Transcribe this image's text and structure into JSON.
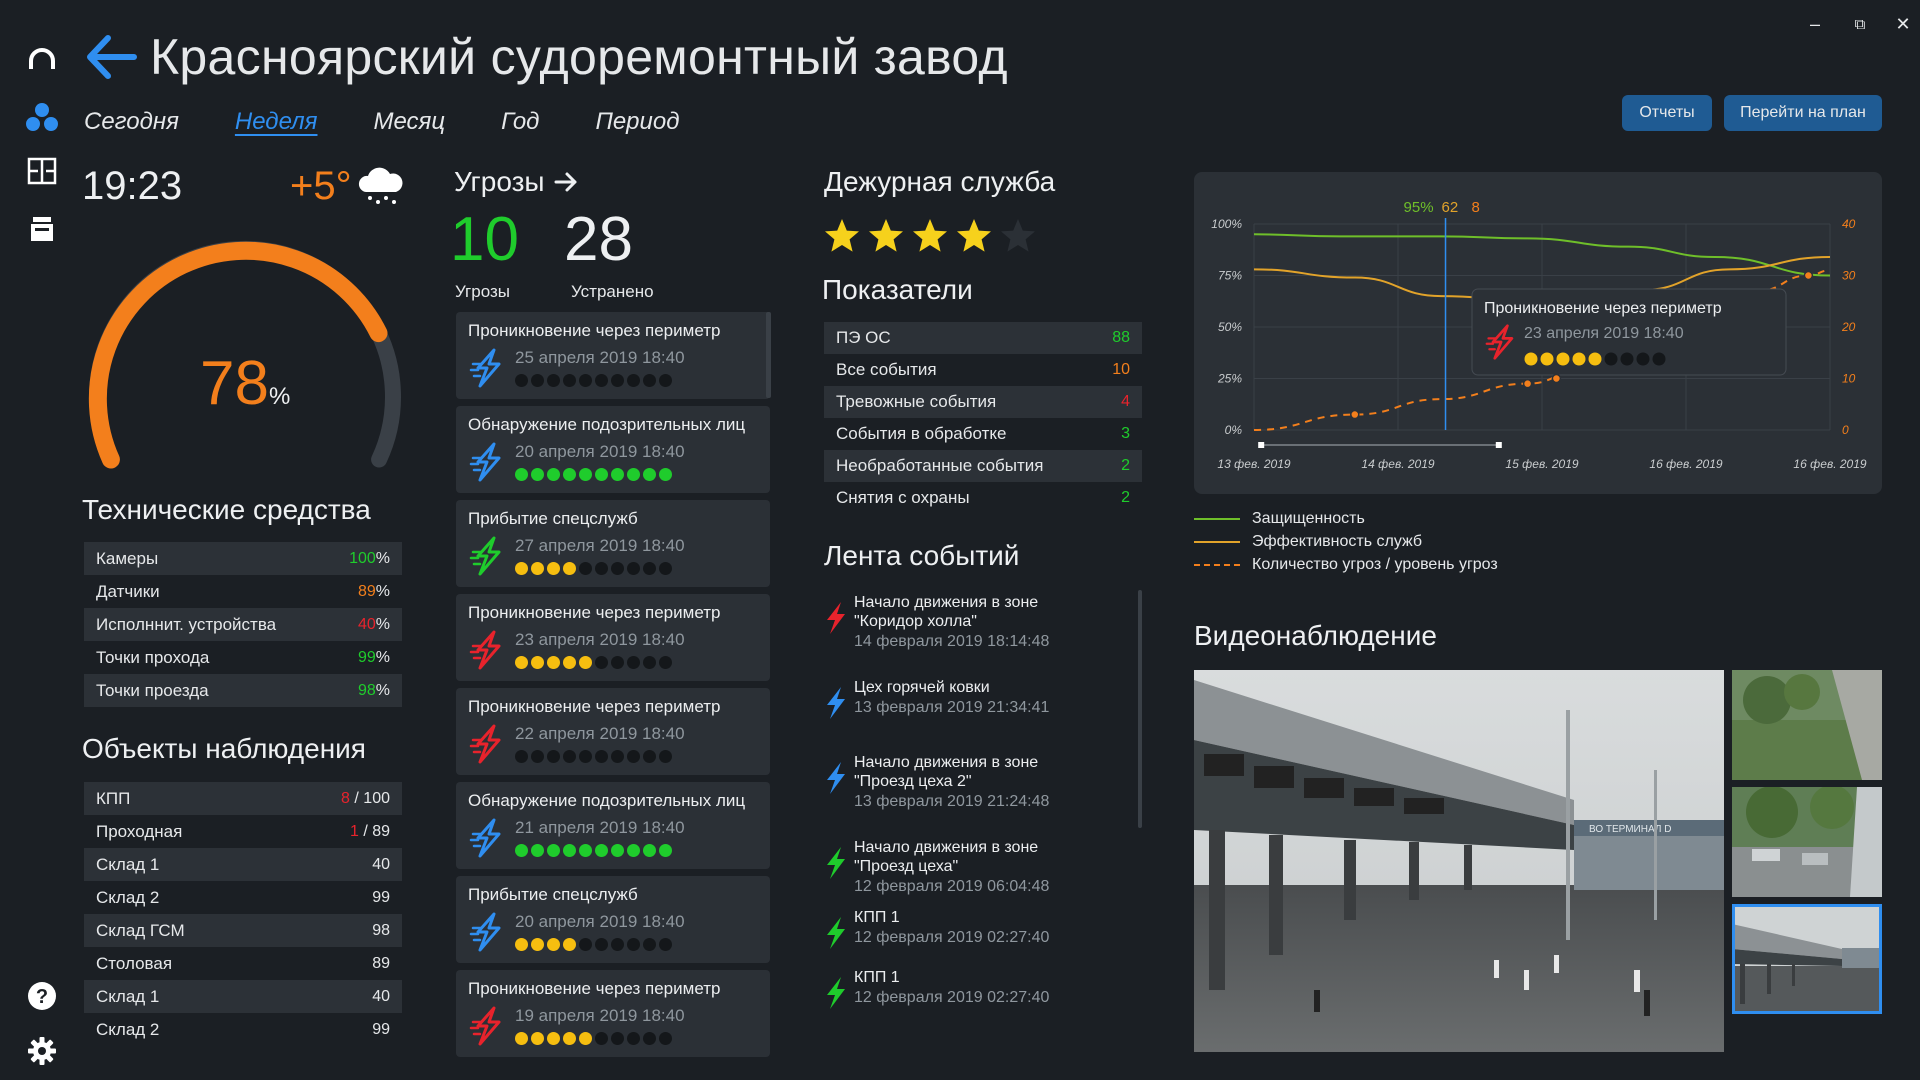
{
  "app": {
    "title": "Красноярский судоремонтный завод"
  },
  "colors": {
    "background": "#1b1f24",
    "panel": "#2b3036",
    "accent": "#2f8ef0",
    "orange": "#f37f1c",
    "green": "#1fcc2c",
    "red": "#e8232c",
    "yellow": "#f6be10",
    "blue_bolt": "#2f8ef0"
  },
  "rail": {
    "icons": [
      "headset-icon",
      "users-icon",
      "plan-icon",
      "archive-icon",
      "help-icon",
      "settings-icon"
    ]
  },
  "window": {
    "minimize": "‒",
    "restore": "⧉",
    "close": "✕"
  },
  "tabs": [
    {
      "label": "Сегодня",
      "active": false
    },
    {
      "label": "Неделя",
      "active": true
    },
    {
      "label": "Месяц",
      "active": false
    },
    {
      "label": "Год",
      "active": false
    },
    {
      "label": "Период",
      "active": false
    }
  ],
  "buttons": {
    "reports": "Отчеты",
    "go_to_plan": "Перейти на план"
  },
  "status": {
    "time": "19:23",
    "temperature": "+5°",
    "weather_icon": "snow-cloud-icon"
  },
  "gauge": {
    "value": "78",
    "unit": "%",
    "fraction": 0.78
  },
  "tech": {
    "title": "Технические средства",
    "rows": [
      {
        "label": "Камеры",
        "value": "100",
        "unit": "%",
        "color": "#1fcc2c"
      },
      {
        "label": "Датчики",
        "value": "89",
        "unit": "%",
        "color": "#f37f1c"
      },
      {
        "label": "Исполннит. устройства",
        "value": "40",
        "unit": "%",
        "color": "#e8232c"
      },
      {
        "label": "Точки прохода",
        "value": "99",
        "unit": "%",
        "color": "#1fcc2c"
      },
      {
        "label": "Точки проезда",
        "value": "98",
        "unit": "%",
        "color": "#1fcc2c"
      }
    ]
  },
  "objects": {
    "title": "Объекты наблюдения",
    "rows": [
      {
        "label": "КПП",
        "alert": "8",
        "value": "/ 100"
      },
      {
        "label": "Проходная",
        "alert": "1",
        "value": "/ 89"
      },
      {
        "label": "Склад 1",
        "alert": "",
        "value": "40"
      },
      {
        "label": "Склад 2",
        "alert": "",
        "value": "99"
      },
      {
        "label": "Склад ГСМ",
        "alert": "",
        "value": "98"
      },
      {
        "label": "Столовая",
        "alert": "",
        "value": "89"
      },
      {
        "label": "Склад 1",
        "alert": "",
        "value": "40"
      },
      {
        "label": "Склад 2",
        "alert": "",
        "value": "99"
      }
    ]
  },
  "threats": {
    "title": "Угрозы",
    "active_count": "10",
    "active_label": "Угрозы",
    "resolved_count": "28",
    "resolved_label": "Устранено",
    "cards": [
      {
        "title": "Проникновение через периметр",
        "date": "25 апреля 2019  18:40",
        "bolt": "blue",
        "level": 0,
        "dot_color": "y"
      },
      {
        "title": "Обнаружение подозрительных лиц",
        "date": "20 апреля 2019  18:40",
        "bolt": "blue",
        "level": 10,
        "dot_color": "g"
      },
      {
        "title": "Прибытие спецслужб",
        "date": "27 апреля 2019  18:40",
        "bolt": "green",
        "level": 4,
        "dot_color": "y"
      },
      {
        "title": "Проникновение через периметр",
        "date": "23 апреля 2019  18:40",
        "bolt": "red",
        "level": 5,
        "dot_color": "y"
      },
      {
        "title": "Проникновение через периметр",
        "date": "22 апреля 2019  18:40",
        "bolt": "red",
        "level": 0,
        "dot_color": "y"
      },
      {
        "title": "Обнаружение подозрительных лиц",
        "date": "21 апреля 2019  18:40",
        "bolt": "blue",
        "level": 10,
        "dot_color": "g"
      },
      {
        "title": "Прибытие спецслужб",
        "date": "20 апреля 2019  18:40",
        "bolt": "blue",
        "level": 4,
        "dot_color": "y"
      },
      {
        "title": "Проникновение через периметр",
        "date": "19 апреля 2019  18:40",
        "bolt": "red",
        "level": 5,
        "dot_color": "y"
      }
    ]
  },
  "duty": {
    "title": "Дежурная служба",
    "rating": 4,
    "max_rating": 5
  },
  "indicators": {
    "title": "Показатели",
    "rows": [
      {
        "label": "ПЭ ОС",
        "value": "88",
        "color": "#1fcc2c"
      },
      {
        "label": "Все события",
        "value": "10",
        "color": "#f37f1c"
      },
      {
        "label": "Тревожные события",
        "value": "4",
        "color": "#e8232c"
      },
      {
        "label": "События в обработке",
        "value": "3",
        "color": "#1fcc2c"
      },
      {
        "label": "Необработанные события",
        "value": "2",
        "color": "#1fcc2c"
      },
      {
        "label": "Снятия с охраны",
        "value": "2",
        "color": "#1fcc2c"
      }
    ]
  },
  "feed": {
    "title": "Лента событий",
    "events": [
      {
        "text": "Начало движения в зоне\n\"Коридор холла\"",
        "date": "14 февраля 2019  18:14:48",
        "bolt": "red"
      },
      {
        "text": "Цех горячей ковки",
        "date": "13 февраля 2019  21:34:41",
        "bolt": "blue"
      },
      {
        "text": "Начало движения в зоне\n\"Проезд цеха 2\"",
        "date": "13 февраля 2019  21:24:48",
        "bolt": "blue"
      },
      {
        "text": "Начало движения в зоне\n\"Проезд цеха\"",
        "date": "12 февраля 2019  06:04:48",
        "bolt": "green"
      },
      {
        "text": "КПП 1",
        "date": "12 февраля 2019  02:27:40",
        "bolt": "green"
      },
      {
        "text": "КПП 1",
        "date": "12 февраля 2019  02:27:40",
        "bolt": "green"
      }
    ]
  },
  "chart_data": {
    "type": "line",
    "x": [
      "13 фев. 2019",
      "14 фев. 2019",
      "15 фев. 2019",
      "16 фев. 2019",
      "16 фев. 2019"
    ],
    "y_left_ticks": [
      "100%",
      "75%",
      "50%",
      "25%",
      "0%"
    ],
    "y_right_ticks": [
      "40",
      "30",
      "20",
      "10",
      "0"
    ],
    "ylim_left": [
      0,
      100
    ],
    "ylim_right": [
      0,
      40
    ],
    "cursor_values": {
      "protection": "95%",
      "efficiency": "62",
      "threats": "8"
    },
    "series": [
      {
        "name": "Защищенность",
        "color": "#6fbf2a",
        "axis": "left",
        "points": [
          [
            0,
            95
          ],
          [
            0.6,
            94
          ],
          [
            1.3,
            94
          ],
          [
            1.9,
            93
          ],
          [
            2.6,
            89
          ],
          [
            3.2,
            84
          ],
          [
            4,
            75
          ]
        ]
      },
      {
        "name": "Эффективность служб",
        "color": "#e2a32a",
        "axis": "left",
        "points": [
          [
            0,
            78
          ],
          [
            0.7,
            74
          ],
          [
            1.3,
            65
          ],
          [
            1.9,
            63
          ],
          [
            2.7,
            68
          ],
          [
            3.3,
            78
          ],
          [
            4,
            84
          ]
        ]
      },
      {
        "name": "Количество угроз / уровень угроз",
        "color": "#f37f1c",
        "axis": "right",
        "dashed": true,
        "points": [
          [
            0,
            0
          ],
          [
            0.7,
            3
          ],
          [
            1.3,
            6
          ],
          [
            1.9,
            9
          ],
          [
            2.3,
            12
          ],
          [
            2.9,
            18
          ],
          [
            3.5,
            27
          ],
          [
            3.85,
            30
          ],
          [
            4,
            31
          ]
        ]
      }
    ],
    "tooltip": {
      "title": "Проникновение через периметр",
      "date": "23 апреля 2019  18:40",
      "level": 5,
      "max": 9
    },
    "grid": true
  },
  "video": {
    "title": "Видеонаблюдение",
    "sign_text": "ВО ТЕРМИНАЛ D",
    "selected_thumb": 3
  }
}
